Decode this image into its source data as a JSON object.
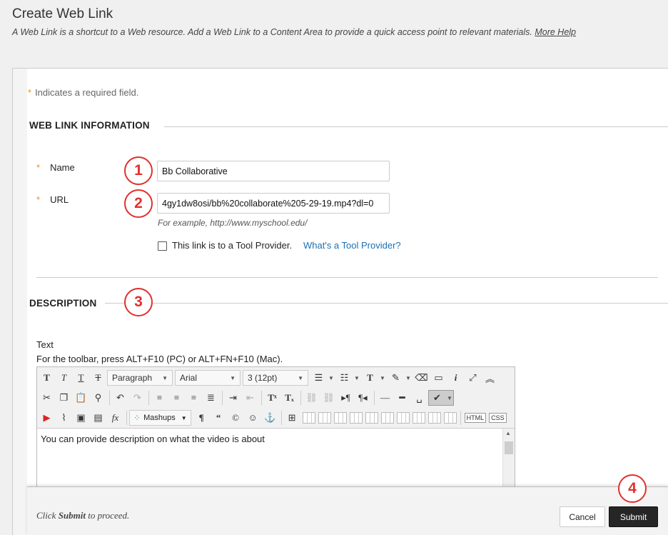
{
  "header": {
    "title": "Create Web Link",
    "subtitle": "A Web Link is a shortcut to a Web resource. Add a Web Link to a Content Area to provide a quick access point to relevant materials.",
    "help_link": "More Help"
  },
  "form": {
    "required_note": "Indicates a required field.",
    "required_mark": "*",
    "section_info": "WEB LINK INFORMATION",
    "name_label": "Name",
    "name_value": "Bb Collaborative",
    "url_label": "URL",
    "url_value": "4gy1dw8osi/bb%20collaborate%205-29-19.mp4?dl=0",
    "url_hint": "For example, http://www.myschool.edu/",
    "tool_provider_label": "This link is to a Tool Provider.",
    "tool_provider_help": "What's a Tool Provider?",
    "section_description": "DESCRIPTION",
    "text_label": "Text",
    "toolbar_hint": "For the toolbar, press ALT+F10 (PC) or ALT+FN+F10 (Mac)."
  },
  "editor": {
    "paragraph_select": "Paragraph",
    "font_select": "Arial",
    "size_select": "3 (12pt)",
    "mashups_label": "Mashups",
    "html_label": "HTML",
    "css_label": "CSS",
    "content": "You can provide description on what the video is about"
  },
  "callouts": [
    "1",
    "2",
    "3",
    "4"
  ],
  "footer": {
    "text_prefix": "Click",
    "text_bold": "Submit",
    "text_suffix": "to proceed.",
    "cancel_label": "Cancel",
    "submit_label": "Submit"
  },
  "colors": {
    "required_star": "#f08a24",
    "callout": "#e1302d",
    "link": "#1a6fb5",
    "submit_bg": "#262626"
  }
}
